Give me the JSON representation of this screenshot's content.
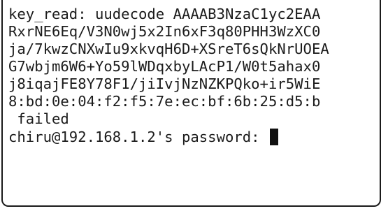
{
  "terminal": {
    "lines": [
      "key_read: uudecode AAAAB3NzaC1yc2EAA",
      "RxrNE6Eq/V3N0wj5x2In6xF3q80PHH3WzXC0",
      "ja/7kwzCNXwIu9xkvqH6D+XSreT6sQkNrUOEA",
      "G7wbjm6W6+Yo59lWDqxbyLAcP1/W0t5ahax0",
      "j8iqajFE8Y78F1/jiIvjNzNZKPQko+ir5WiE",
      "8:bd:0e:04:f2:f5:7e:ec:bf:6b:25:d5:b",
      " failed",
      "chiru@192.168.1.2's password: "
    ],
    "cursor": "block-cursor"
  }
}
